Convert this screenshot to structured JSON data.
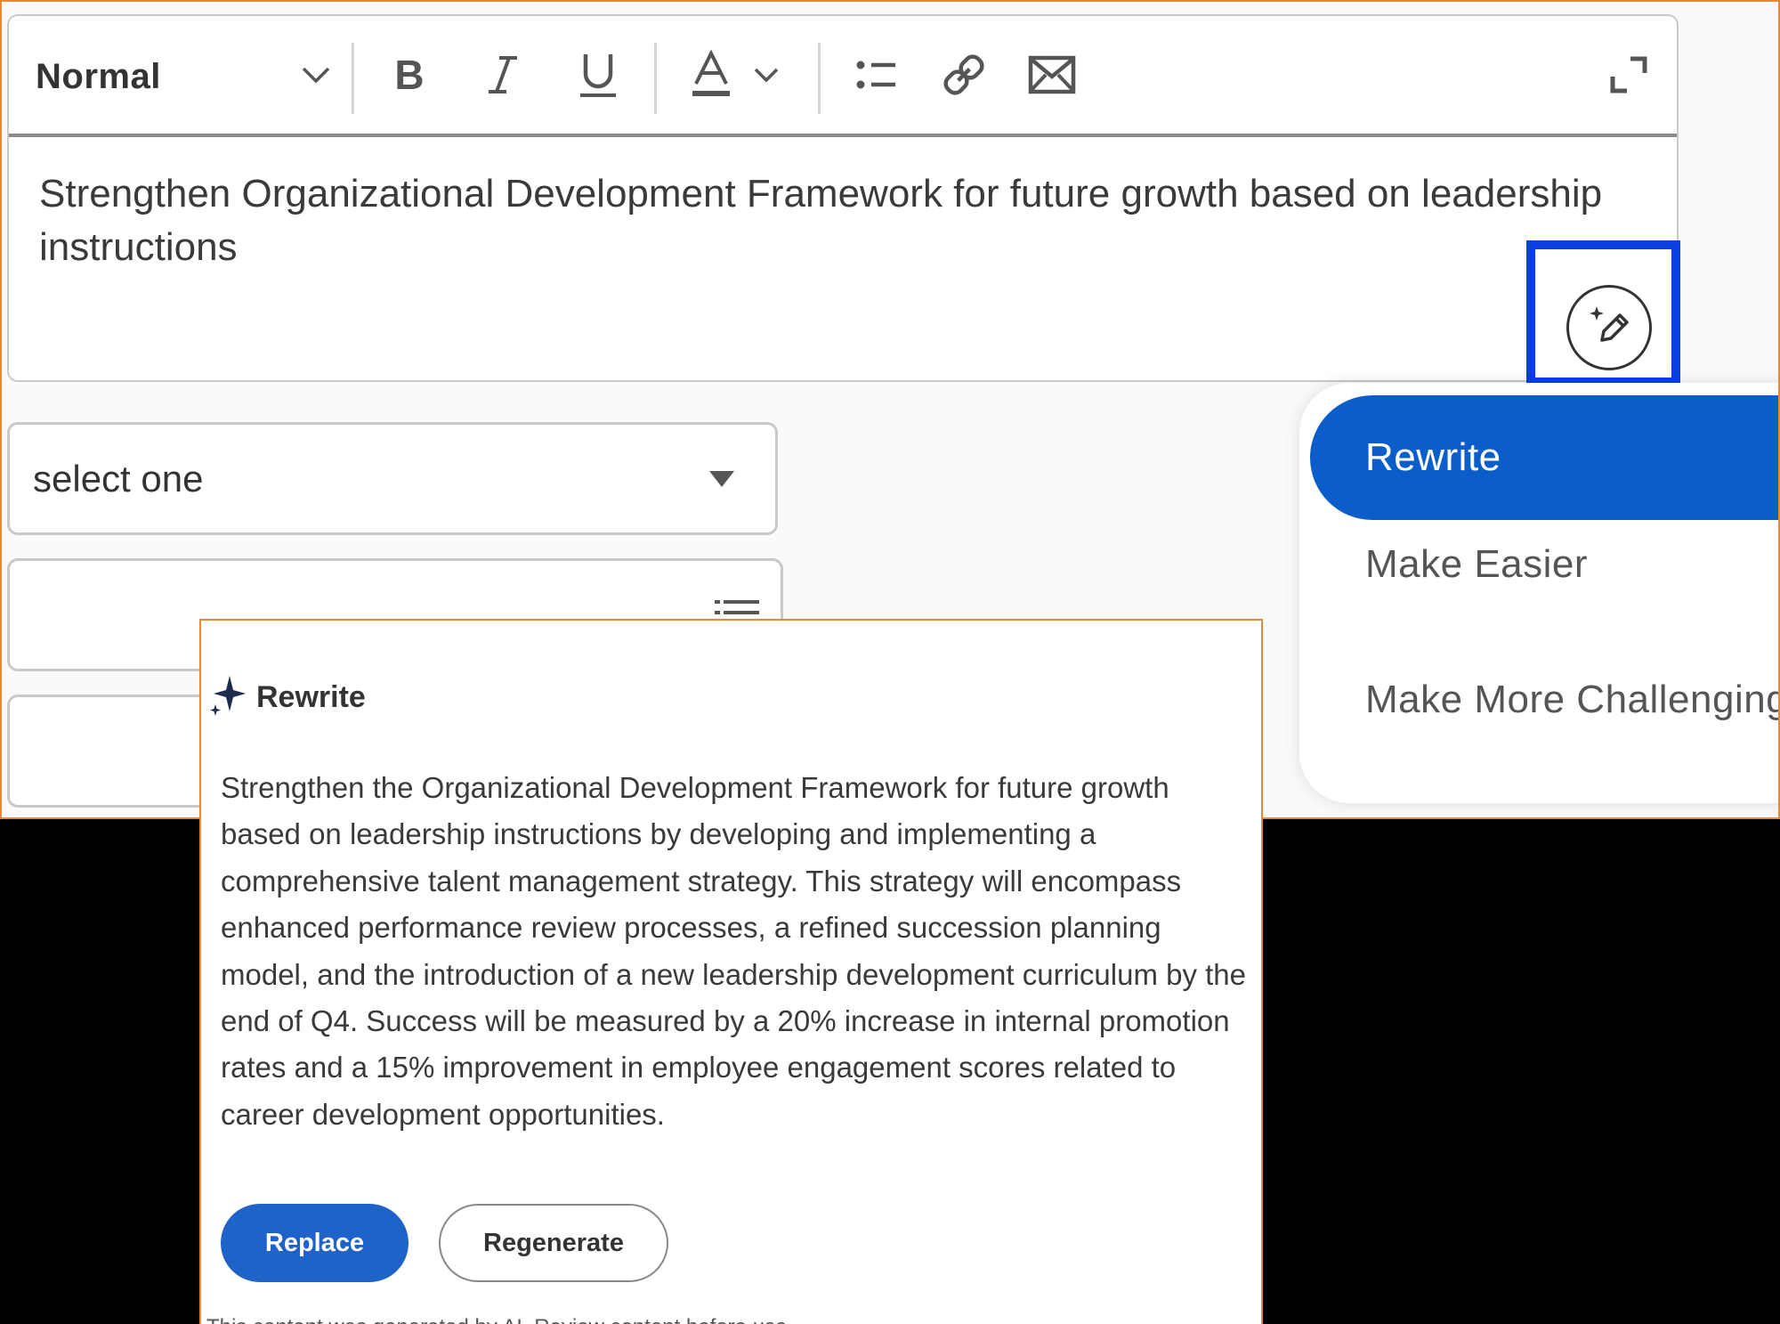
{
  "editor": {
    "text_style": "Normal",
    "content": "Strengthen Organizational Development Framework for future growth based on leadership instructions",
    "toolbar_icons": [
      "chevron-down-icon",
      "bold-icon",
      "italic-icon",
      "underline-icon",
      "font-color-icon",
      "bullet-list-icon",
      "link-icon",
      "email-icon",
      "expand-icon"
    ]
  },
  "form": {
    "select_placeholder": "select one"
  },
  "menu": {
    "items": [
      {
        "label": "Rewrite",
        "active": true
      },
      {
        "label": "Make Easier",
        "active": false
      },
      {
        "label": "Make More Challenging",
        "active": false
      }
    ]
  },
  "card": {
    "title": "Rewrite",
    "body": "Strengthen the Organizational Development Framework for future growth based on leadership instructions by developing and implementing a comprehensive talent management strategy. This strategy will encompass enhanced performance review processes, a refined succession planning model, and the introduction of a new leadership development curriculum by the end of Q4. Success will be measured by a 20% increase in internal promotion rates and a 15% improvement in employee engagement scores related to career development opportunities.",
    "replace_label": "Replace",
    "regenerate_label": "Regenerate",
    "footnote": "This content was generated by AI. Review content before use."
  },
  "colors": {
    "accent_blue": "#0b5ec9",
    "highlight_blue": "#0a3fe0",
    "frame_orange": "#e8893a"
  }
}
